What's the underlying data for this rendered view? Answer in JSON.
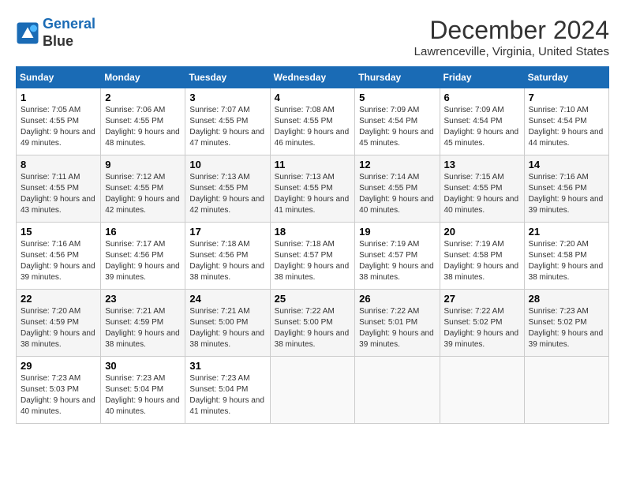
{
  "header": {
    "logo_line1": "General",
    "logo_line2": "Blue",
    "month_title": "December 2024",
    "location": "Lawrenceville, Virginia, United States"
  },
  "days_of_week": [
    "Sunday",
    "Monday",
    "Tuesday",
    "Wednesday",
    "Thursday",
    "Friday",
    "Saturday"
  ],
  "weeks": [
    [
      {
        "day": "1",
        "sunrise": "7:05 AM",
        "sunset": "4:55 PM",
        "daylight": "9 hours and 49 minutes."
      },
      {
        "day": "2",
        "sunrise": "7:06 AM",
        "sunset": "4:55 PM",
        "daylight": "9 hours and 48 minutes."
      },
      {
        "day": "3",
        "sunrise": "7:07 AM",
        "sunset": "4:55 PM",
        "daylight": "9 hours and 47 minutes."
      },
      {
        "day": "4",
        "sunrise": "7:08 AM",
        "sunset": "4:55 PM",
        "daylight": "9 hours and 46 minutes."
      },
      {
        "day": "5",
        "sunrise": "7:09 AM",
        "sunset": "4:54 PM",
        "daylight": "9 hours and 45 minutes."
      },
      {
        "day": "6",
        "sunrise": "7:09 AM",
        "sunset": "4:54 PM",
        "daylight": "9 hours and 45 minutes."
      },
      {
        "day": "7",
        "sunrise": "7:10 AM",
        "sunset": "4:54 PM",
        "daylight": "9 hours and 44 minutes."
      }
    ],
    [
      {
        "day": "8",
        "sunrise": "7:11 AM",
        "sunset": "4:55 PM",
        "daylight": "9 hours and 43 minutes."
      },
      {
        "day": "9",
        "sunrise": "7:12 AM",
        "sunset": "4:55 PM",
        "daylight": "9 hours and 42 minutes."
      },
      {
        "day": "10",
        "sunrise": "7:13 AM",
        "sunset": "4:55 PM",
        "daylight": "9 hours and 42 minutes."
      },
      {
        "day": "11",
        "sunrise": "7:13 AM",
        "sunset": "4:55 PM",
        "daylight": "9 hours and 41 minutes."
      },
      {
        "day": "12",
        "sunrise": "7:14 AM",
        "sunset": "4:55 PM",
        "daylight": "9 hours and 40 minutes."
      },
      {
        "day": "13",
        "sunrise": "7:15 AM",
        "sunset": "4:55 PM",
        "daylight": "9 hours and 40 minutes."
      },
      {
        "day": "14",
        "sunrise": "7:16 AM",
        "sunset": "4:56 PM",
        "daylight": "9 hours and 39 minutes."
      }
    ],
    [
      {
        "day": "15",
        "sunrise": "7:16 AM",
        "sunset": "4:56 PM",
        "daylight": "9 hours and 39 minutes."
      },
      {
        "day": "16",
        "sunrise": "7:17 AM",
        "sunset": "4:56 PM",
        "daylight": "9 hours and 39 minutes."
      },
      {
        "day": "17",
        "sunrise": "7:18 AM",
        "sunset": "4:56 PM",
        "daylight": "9 hours and 38 minutes."
      },
      {
        "day": "18",
        "sunrise": "7:18 AM",
        "sunset": "4:57 PM",
        "daylight": "9 hours and 38 minutes."
      },
      {
        "day": "19",
        "sunrise": "7:19 AM",
        "sunset": "4:57 PM",
        "daylight": "9 hours and 38 minutes."
      },
      {
        "day": "20",
        "sunrise": "7:19 AM",
        "sunset": "4:58 PM",
        "daylight": "9 hours and 38 minutes."
      },
      {
        "day": "21",
        "sunrise": "7:20 AM",
        "sunset": "4:58 PM",
        "daylight": "9 hours and 38 minutes."
      }
    ],
    [
      {
        "day": "22",
        "sunrise": "7:20 AM",
        "sunset": "4:59 PM",
        "daylight": "9 hours and 38 minutes."
      },
      {
        "day": "23",
        "sunrise": "7:21 AM",
        "sunset": "4:59 PM",
        "daylight": "9 hours and 38 minutes."
      },
      {
        "day": "24",
        "sunrise": "7:21 AM",
        "sunset": "5:00 PM",
        "daylight": "9 hours and 38 minutes."
      },
      {
        "day": "25",
        "sunrise": "7:22 AM",
        "sunset": "5:00 PM",
        "daylight": "9 hours and 38 minutes."
      },
      {
        "day": "26",
        "sunrise": "7:22 AM",
        "sunset": "5:01 PM",
        "daylight": "9 hours and 39 minutes."
      },
      {
        "day": "27",
        "sunrise": "7:22 AM",
        "sunset": "5:02 PM",
        "daylight": "9 hours and 39 minutes."
      },
      {
        "day": "28",
        "sunrise": "7:23 AM",
        "sunset": "5:02 PM",
        "daylight": "9 hours and 39 minutes."
      }
    ],
    [
      {
        "day": "29",
        "sunrise": "7:23 AM",
        "sunset": "5:03 PM",
        "daylight": "9 hours and 40 minutes."
      },
      {
        "day": "30",
        "sunrise": "7:23 AM",
        "sunset": "5:04 PM",
        "daylight": "9 hours and 40 minutes."
      },
      {
        "day": "31",
        "sunrise": "7:23 AM",
        "sunset": "5:04 PM",
        "daylight": "9 hours and 41 minutes."
      },
      null,
      null,
      null,
      null
    ]
  ]
}
